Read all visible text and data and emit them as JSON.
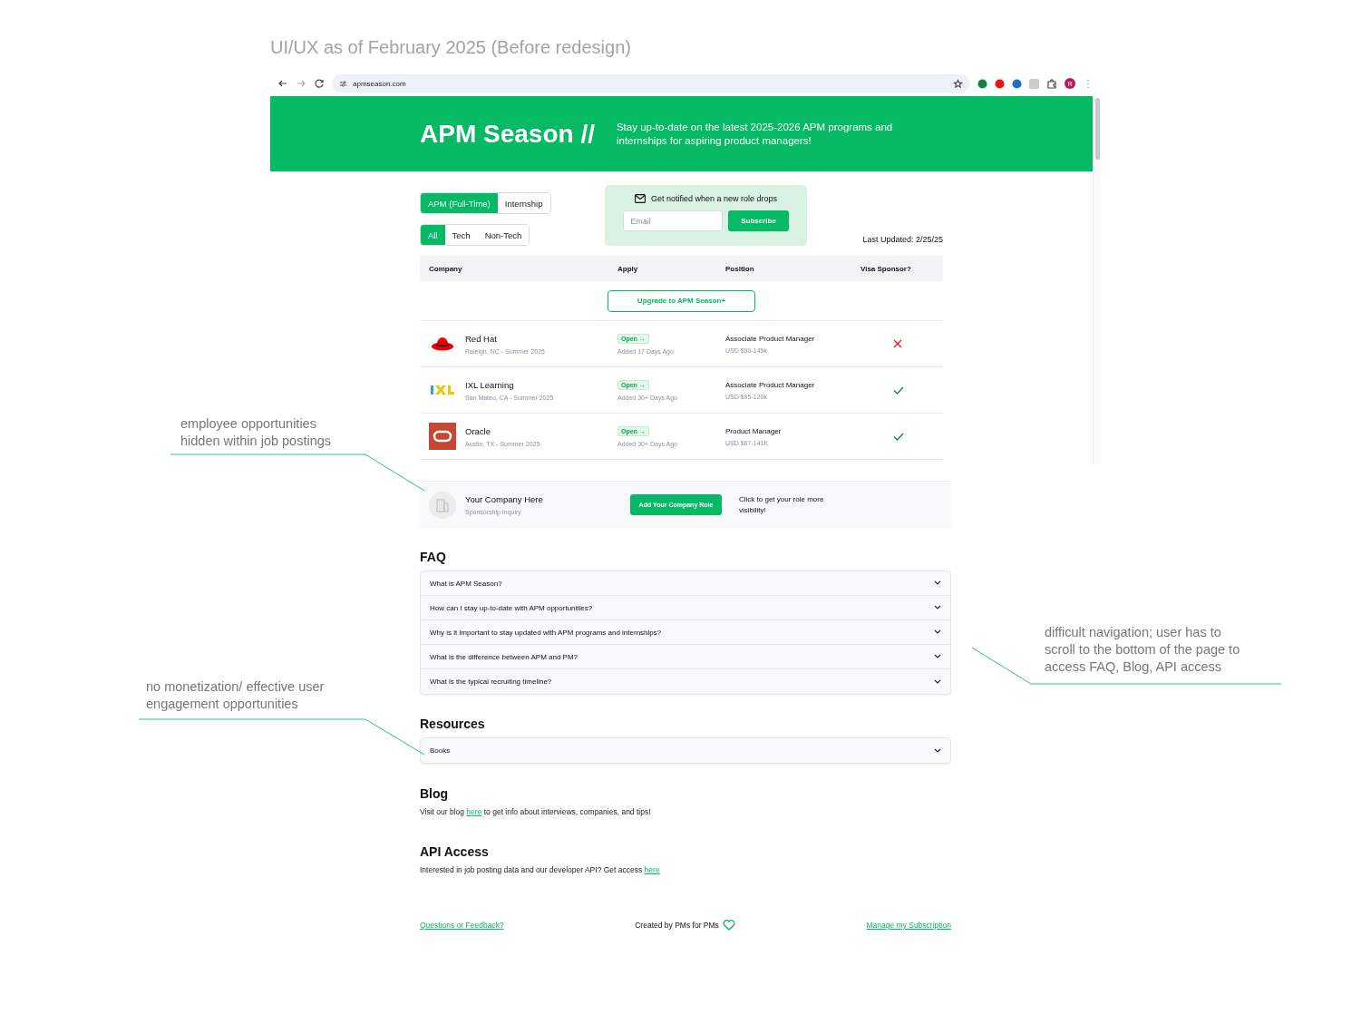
{
  "slide_title": "UI/UX as of February 2025 (Before redesign)",
  "browser": {
    "url": "apmseason.com",
    "avatar": "R"
  },
  "header": {
    "logo": "APM Season //",
    "tagline": "Stay up-to-date on the latest 2025-2026 APM programs and internships for aspiring product managers!"
  },
  "type_tabs": [
    {
      "label": "APM (Full-Time)",
      "selected": true
    },
    {
      "label": "Internship",
      "selected": false
    }
  ],
  "category_tabs": [
    {
      "label": "All",
      "selected": true
    },
    {
      "label": "Tech",
      "selected": false
    },
    {
      "label": "Non-Tech",
      "selected": false
    }
  ],
  "notify": {
    "text": "Get notified when a new role drops",
    "email_placeholder": "Email",
    "button": "Subscribe"
  },
  "last_updated": "Last Updated: 2/25/25",
  "table": {
    "columns": [
      "Company",
      "Apply",
      "Position",
      "Visa Sponsor?"
    ],
    "upgrade_button": "Upgrade to APM Season+",
    "rows": [
      {
        "kind": "redhat",
        "company": "Red Hat",
        "location": "Raleigh, NC - Summer 2025",
        "status": "Open →",
        "added": "Added 17 Days Ago",
        "position": "Associate Product Manager",
        "salary": "USD $90-145k",
        "visa_sponsor": false
      },
      {
        "kind": "ixl",
        "company": "IXL Learning",
        "location": "San Mateo, CA - Summer 2025",
        "status": "Open →",
        "added": "Added 30+ Days Ago",
        "position": "Associate Product Manager",
        "salary": "USD $95-120k",
        "visa_sponsor": true
      },
      {
        "kind": "oracle",
        "company": "Oracle",
        "location": "Austin, TX - Summer 2025",
        "status": "Open →",
        "added": "Added 30+ Days Ago",
        "position": "Product Manager",
        "salary": "USD $67-141K",
        "visa_sponsor": true
      }
    ]
  },
  "sponsor": {
    "company": "Your Company Here",
    "subtitle": "Sponsorship Inquiry",
    "button": "Add Your Company Role",
    "note": "Click to get your role more visibility!"
  },
  "faq": {
    "title": "FAQ",
    "items": [
      "What is APM Season?",
      "How can I stay up-to-date with APM opportunities?",
      "Why is it important to stay updated with APM programs and internships?",
      "What is the difference between APM and PM?",
      "What is the typical recruiting timeline?"
    ]
  },
  "resources": {
    "title": "Resources",
    "items": [
      "Books"
    ]
  },
  "blog": {
    "title": "Blog",
    "before": "Visit our blog ",
    "link": "here",
    "after": " to get info about interviews, companies, and tips!"
  },
  "api": {
    "title": "API Access",
    "before": "Interested in job posting data and our developer API? Get access ",
    "link": "here"
  },
  "footer": {
    "feedback": "Questions or Feedback?",
    "credit": "Created by PMs for PMs",
    "subscription": "Manage my Subscription"
  },
  "annotations": [
    {
      "text": "employee opportunities\nhidden within job postings"
    },
    {
      "text": "no monetization/ effective user\nengagement opportunities"
    },
    {
      "text": "difficult navigation; user has to\nscroll to the bottom of the page to\naccess FAQ, Blog, API access"
    }
  ]
}
